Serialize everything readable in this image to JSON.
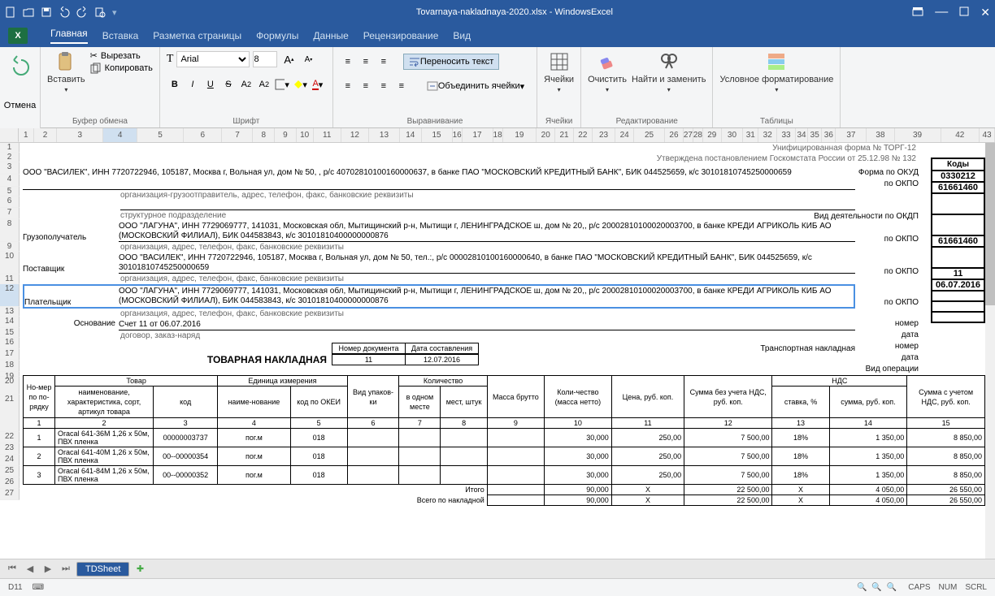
{
  "window": {
    "title": "Tovarnaya-nakladnaya-2020.xlsx - WindowsExcel"
  },
  "qat": {
    "new": "new",
    "open": "open",
    "save": "save",
    "undo": "undo",
    "redo": "redo",
    "preview": "preview"
  },
  "tabs": {
    "home": "Главная",
    "insert": "Вставка",
    "layout": "Разметка страницы",
    "formulas": "Формулы",
    "data": "Данные",
    "review": "Рецензирование",
    "view": "Вид"
  },
  "ribbon": {
    "undo": "Отмена",
    "paste": "Вставить",
    "cut": "Вырезать",
    "copy": "Копировать",
    "clipboard": "Буфер обмена",
    "font_group": "Шрифт",
    "align_group": "Выравнивание",
    "cells_group": "Ячейки",
    "edit_group": "Редактирование",
    "tables_group": "Таблицы",
    "wrap": "Переносить текст",
    "merge": "Объединить ячейки",
    "cells": "Ячейки",
    "clear": "Очистить",
    "find": "Найти и заменить",
    "condfmt": "Условное форматирование",
    "font_name": "Arial",
    "font_size": "8"
  },
  "cols": [
    "1",
    "2",
    "3",
    "4",
    "5",
    "6",
    "7",
    "8",
    "9",
    "10",
    "11",
    "12",
    "13",
    "14",
    "15",
    "16",
    "17",
    "18",
    "19",
    "20",
    "21",
    "22",
    "23",
    "24",
    "25",
    "26",
    "27",
    "28",
    "29",
    "30",
    "31",
    "32",
    "33",
    "34",
    "35",
    "36",
    "37",
    "38",
    "39",
    "42",
    "43"
  ],
  "doc": {
    "form_note1": "Унифицированная форма № ТОРГ-12",
    "form_note2": "Утверждена постановлением Госкомстата России от 25.12.98 № 132",
    "kody": "Коды",
    "okud_lbl": "Форма по ОКУД",
    "okud": "0330212",
    "okpo_lbl": "по ОКПО",
    "okpo1": "61661460",
    "okpo2": "",
    "okpo3": "61661460",
    "okpo4": "",
    "okdp_lbl": "Вид деятельности по ОКДП",
    "sender": "ООО \"ВАСИЛЕК\", ИНН 7720722946, 105187, Москва г, Вольная ул, дом № 50, , р/с 40702810100160000637, в банке ПАО \"МОСКОВСКИЙ КРЕДИТНЫЙ БАНК\", БИК 044525659, к/с 30101810745250000659",
    "sender_note": "организация-грузоотправитель, адрес, телефон, факс, банковские реквизиты",
    "struct_note": "структурное подразделение",
    "recipient_lbl": "Грузополучатель",
    "recipient": "ООО \"ЛАГУНА\", ИНН 7729069777, 141031, Московская обл, Мытищинский р-н, Мытищи г, ЛЕНИНГРАДСКОЕ ш, дом № 20,, р/с 20002810100020003700, в банке КРЕДИ АГРИКОЛЬ КИБ АО (МОСКОВСКИЙ ФИЛИАЛ), БИК 044583843, к/с 30101810400000000876",
    "org_note": "организация, адрес, телефон, факс, банковские реквизиты",
    "supplier_lbl": "Поставщик",
    "supplier": "ООО \"ВАСИЛЕК\", ИНН 7720722946, 105187, Москва г, Вольная ул, дом № 50,  тел.:, р/с 00002810100160000640, в банке ПАО \"МОСКОВСКИЙ КРЕДИТНЫЙ БАНК\", БИК 044525659, к/с 30101810745250000659",
    "payer_lbl": "Плательщик",
    "payer": "ООО \"ЛАГУНА\", ИНН 7729069777, 141031, Московская обл, Мытищинский р-н, Мытищи г, ЛЕНИНГРАДСКОЕ ш, дом № 20,, р/с 20002810100020003700, в банке КРЕДИ АГРИКОЛЬ КИБ АО (МОСКОВСКИЙ ФИЛИАЛ), БИК 044583843, к/с 30101810400000000876",
    "basis_lbl": "Основание",
    "basis": "Счет 11 от 06.07.2016",
    "basis_note": "договор, заказ-наряд",
    "num_lbl": "номер",
    "num": "11",
    "date_lbl": "дата",
    "date": "06.07.2016",
    "trans_lbl": "Транспортная накладная",
    "optype_lbl": "Вид операции",
    "title": "ТОВАРНАЯ НАКЛАДНАЯ",
    "docnum_lbl": "Номер документа",
    "docnum": "11",
    "docdate_lbl": "Дата составления",
    "docdate": "12.07.2016"
  },
  "table": {
    "h_num": "Но-мер по по-рядку",
    "h_goods": "Товар",
    "h_unit": "Единица измерения",
    "h_pack": "Вид упаков-ки",
    "h_qty": "Количество",
    "h_name": "наименование, характеристика, сорт, артикул товара",
    "h_code": "код",
    "h_unitname": "наиме-нование",
    "h_okei": "код по ОКЕИ",
    "h_inone": "в одном месте",
    "h_places": "мест, штук",
    "h_mass": "Масса брутто",
    "h_qtynet": "Коли-чество (масса нетто)",
    "h_price": "Цена, руб. коп.",
    "h_sumnovat": "Сумма без учета НДС, руб. коп.",
    "h_vat": "НДС",
    "h_rate": "ставка, %",
    "h_vatsum": "сумма, руб. коп.",
    "h_total": "Сумма с учетом НДС, руб. коп.",
    "cols": [
      "1",
      "2",
      "3",
      "4",
      "5",
      "6",
      "7",
      "8",
      "9",
      "10",
      "11",
      "12",
      "13",
      "14",
      "15"
    ],
    "rows": [
      {
        "n": "1",
        "name": "Oracal 641-36M 1,26 x 50м, ПВХ пленка",
        "code": "00000003737",
        "unit": "пог.м",
        "okei": "018",
        "q": "30,000",
        "price": "250,00",
        "sum": "7 500,00",
        "rate": "18%",
        "vat": "1 350,00",
        "total": "8 850,00"
      },
      {
        "n": "2",
        "name": "Oracal 641-40M 1,26 x 50м, ПВХ пленка",
        "code": "00--00000354",
        "unit": "пог.м",
        "okei": "018",
        "q": "30,000",
        "price": "250,00",
        "sum": "7 500,00",
        "rate": "18%",
        "vat": "1 350,00",
        "total": "8 850,00"
      },
      {
        "n": "3",
        "name": "Oracal 641-84M 1,26 x 50м, ПВХ пленка",
        "code": "00--00000352",
        "unit": "пог.м",
        "okei": "018",
        "q": "30,000",
        "price": "250,00",
        "sum": "7 500,00",
        "rate": "18%",
        "vat": "1 350,00",
        "total": "8 850,00"
      }
    ],
    "itogo_lbl": "Итого",
    "itogo": {
      "q": "90,000",
      "price": "X",
      "sum": "22 500,00",
      "rate": "X",
      "vat": "4 050,00",
      "total": "26 550,00"
    },
    "grand_lbl": "Всего по накладной",
    "grand": {
      "q": "90,000",
      "price": "X",
      "sum": "22 500,00",
      "rate": "X",
      "vat": "4 050,00",
      "total": "26 550,00"
    }
  },
  "sheets": {
    "active": "TDSheet"
  },
  "status": {
    "cell": "D11",
    "caps": "CAPS",
    "num": "NUM",
    "scrl": "SCRL"
  }
}
